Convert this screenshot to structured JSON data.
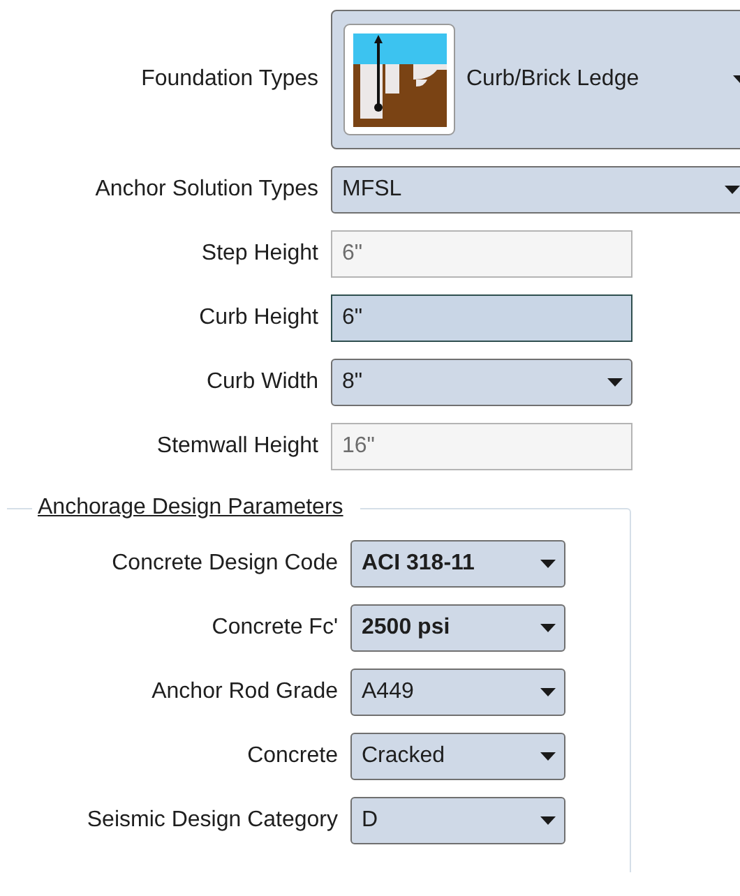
{
  "fields": [
    {
      "kind": "image-combo",
      "label": "Foundation Types",
      "value": "Curb/Brick Ledge",
      "disabled": false,
      "focused": false
    },
    {
      "kind": "combo",
      "label": "Anchor Solution Types",
      "value": "MFSL",
      "disabled": false,
      "focused": false
    },
    {
      "kind": "text",
      "label": "Step Height",
      "value": "6\"",
      "disabled": true,
      "focused": false
    },
    {
      "kind": "text",
      "label": "Curb Height",
      "value": "6\"",
      "disabled": false,
      "focused": true
    },
    {
      "kind": "combo",
      "label": "Curb Width",
      "value": "8\"",
      "disabled": false,
      "focused": false
    },
    {
      "kind": "text",
      "label": "Stemwall Height",
      "value": "16\"",
      "disabled": true,
      "focused": false
    }
  ],
  "anchorage_design_parameters": {
    "title": "Anchorage Design Parameters",
    "fields": [
      {
        "kind": "combo",
        "label": "Concrete Design Code",
        "value": "ACI 318-11",
        "bold": true
      },
      {
        "kind": "combo",
        "label": "Concrete Fc'",
        "value": "2500 psi",
        "bold": true
      },
      {
        "kind": "combo",
        "label": "Anchor Rod Grade",
        "value": "A449",
        "bold": false
      },
      {
        "kind": "combo",
        "label": "Concrete",
        "value": "Cracked",
        "bold": false
      },
      {
        "kind": "combo",
        "label": "Seismic Design Category",
        "value": "D",
        "bold": false
      }
    ]
  }
}
